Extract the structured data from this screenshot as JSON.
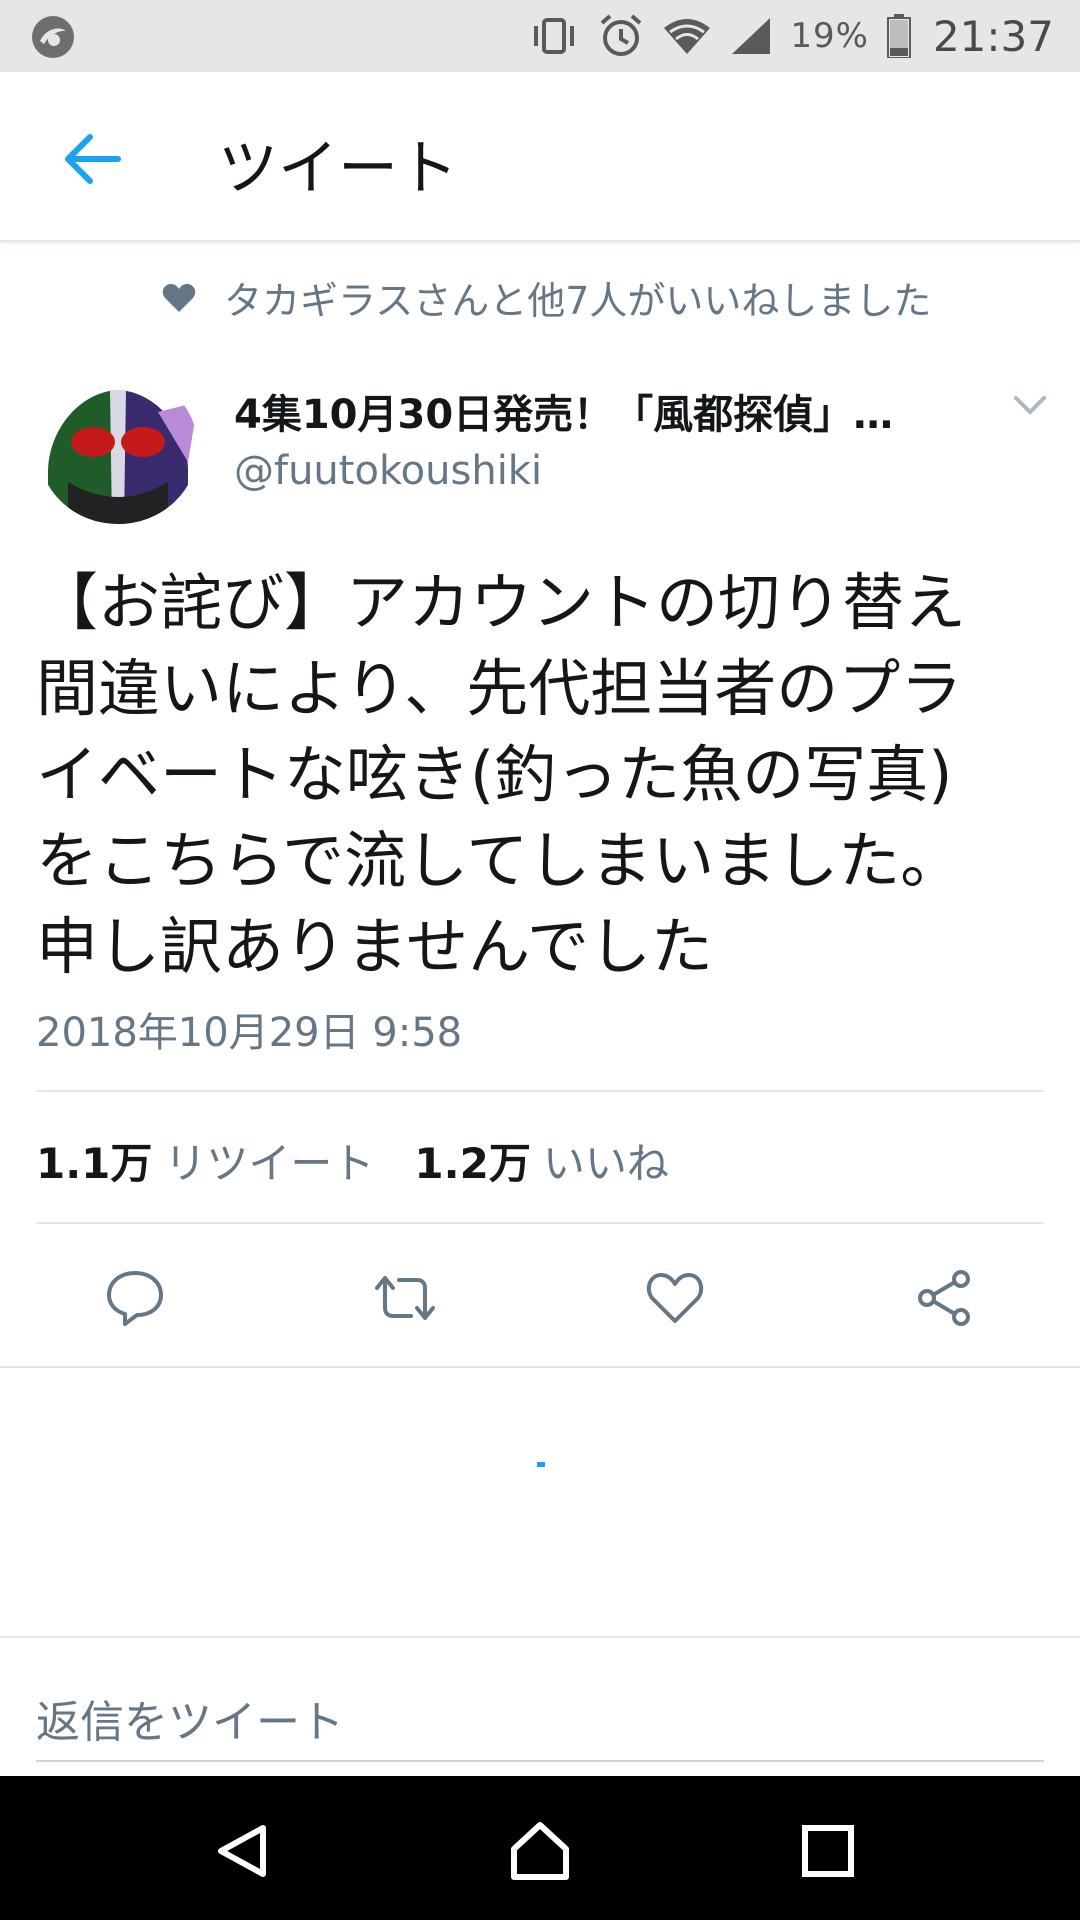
{
  "status_bar": {
    "battery_percent": "19%",
    "time": "21:37",
    "icons": [
      "vibrate-icon",
      "alarm-icon",
      "wifi-icon",
      "signal-icon",
      "battery-icon"
    ]
  },
  "header": {
    "title": "ツイート",
    "back_icon": "arrow-left-icon"
  },
  "social_context": {
    "text": "タカギラスさんと他7人がいいねしました",
    "icon": "heart-icon"
  },
  "tweet": {
    "author_name": "4集10月30日発売！「風都探偵」…",
    "author_handle": "@fuutokoushiki",
    "body_lines": [
      "【お詫び】アカウントの切り替え",
      "間違いにより、先代担当者のプラ",
      "イベートな呟き(釣った魚の写真)",
      "をこちらで流してしまいました。",
      "申し訳ありませんでした"
    ],
    "timestamp": "2018年10月29日 9:58",
    "retweet_count": "1.1万",
    "retweet_label": "リツイート",
    "like_count": "1.2万",
    "like_label": "いいね"
  },
  "reply": {
    "placeholder": "返信をツイート"
  },
  "colors": {
    "accent": "#1da1f2",
    "secondary_text": "#657786",
    "primary_text": "#14171a"
  }
}
